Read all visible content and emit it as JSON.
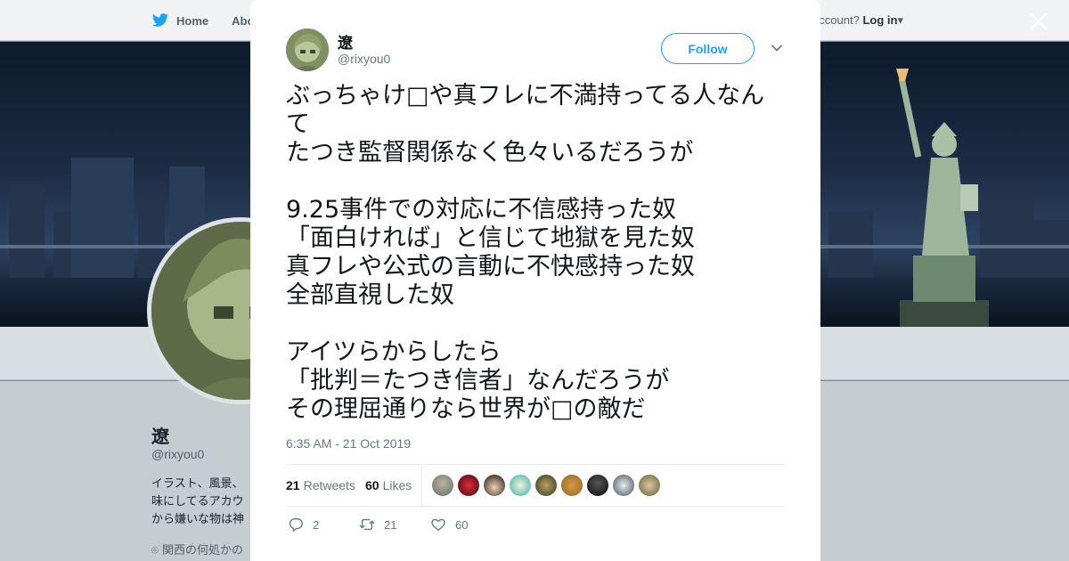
{
  "background": {
    "nav": {
      "home_label": "Home",
      "about_label": "Abo",
      "account_text": "ccount?",
      "login_label": "Log in"
    },
    "profile": {
      "name": "遼",
      "handle": "@rixyou0",
      "bio_lines": [
        "イラスト、風景、",
        "味にしてるアカウ",
        "から嫌いな物は神"
      ],
      "location": "関西の何処かの"
    }
  },
  "tweet": {
    "author_name": "遼",
    "author_handle": "@rixyou0",
    "follow_label": "Follow",
    "text": "ぶっちゃけ□や真フレに不満持ってる人なんて\nたつき監督関係なく色々いるだろうが\n\n9.25事件での対応に不信感持った奴\n「面白ければ」と信じて地獄を見た奴\n真フレや公式の言動に不快感持った奴\n全部直視した奴\n\nアイツらからしたら\n「批判＝たつき信者」なんだろうが\nその理屈通りなら世界が□の敵だ",
    "timestamp": "6:35 AM - 21 Oct 2019",
    "retweets_count": "21",
    "retweets_label": "Retweets",
    "likes_count": "60",
    "likes_label": "Likes",
    "reply_count": "2",
    "action_retweet_count": "21",
    "action_like_count": "60"
  },
  "icons": {
    "close": "close-icon",
    "chevron": "chevron-down-icon",
    "reply": "reply-icon",
    "retweet": "retweet-icon",
    "like": "heart-icon",
    "logo": "twitter-bird-icon",
    "location": "location-pin-icon"
  },
  "colors": {
    "accent": "#1da1f2",
    "text": "#14171a",
    "muted": "#657786",
    "overlay": "#7f8a94"
  }
}
